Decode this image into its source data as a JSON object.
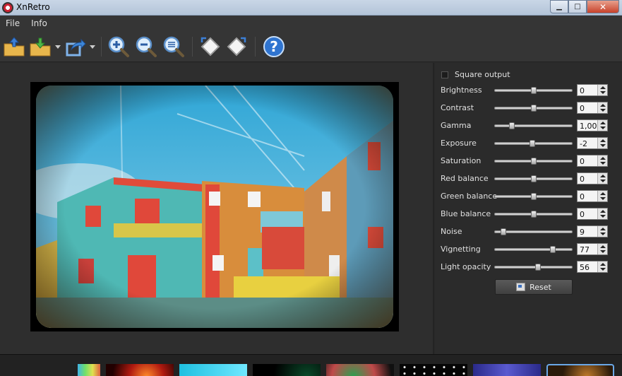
{
  "window": {
    "title": "XnRetro",
    "minimize": "▁",
    "maximize": "□",
    "close": "✕"
  },
  "menu": [
    {
      "label": "File"
    },
    {
      "label": "Info"
    }
  ],
  "toolbar": [
    {
      "icon": "open-folder-icon"
    },
    {
      "icon": "save-folder-icon"
    },
    {
      "icon": "share-export-icon"
    },
    {
      "icon": "zoom-in-icon"
    },
    {
      "icon": "zoom-out-icon"
    },
    {
      "icon": "zoom-fit-icon"
    },
    {
      "icon": "rotate-left-icon"
    },
    {
      "icon": "rotate-right-icon"
    },
    {
      "icon": "help-icon"
    }
  ],
  "options": {
    "square_output_label": "Square output",
    "square_output_checked": false
  },
  "sliders": [
    {
      "label": "Brightness",
      "value": "0",
      "position": 0.5
    },
    {
      "label": "Contrast",
      "value": "0",
      "position": 0.5
    },
    {
      "label": "Gamma",
      "value": "1,00",
      "position": 0.2
    },
    {
      "label": "Exposure",
      "value": "-2",
      "position": 0.49
    },
    {
      "label": "Saturation",
      "value": "0",
      "position": 0.5
    },
    {
      "label": "Red balance",
      "value": "0",
      "position": 0.5
    },
    {
      "label": "Green balance",
      "value": "0",
      "position": 0.5
    },
    {
      "label": "Blue balance",
      "value": "0",
      "position": 0.5
    },
    {
      "label": "Noise",
      "value": "9",
      "position": 0.09
    },
    {
      "label": "Vignetting",
      "value": "77",
      "position": 0.77
    },
    {
      "label": "Light opacity",
      "value": "56",
      "position": 0.56
    }
  ],
  "reset": {
    "label": "Reset"
  },
  "colors": {
    "accent": "#6aa8e8",
    "panel_bg": "#2b2b2b"
  }
}
